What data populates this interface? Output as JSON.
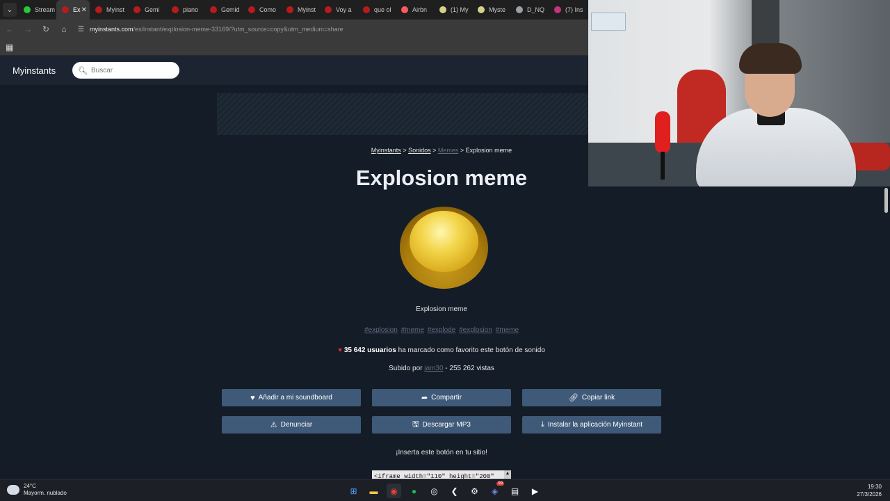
{
  "browser": {
    "tabs": [
      {
        "label": "Stream",
        "color": "#27c93f"
      },
      {
        "label": "Ex",
        "color": "#b71c1c",
        "active": true
      },
      {
        "label": "Myinst",
        "color": "#b71c1c"
      },
      {
        "label": "Gemi",
        "color": "#b71c1c"
      },
      {
        "label": "piano",
        "color": "#b71c1c"
      },
      {
        "label": "Gemid",
        "color": "#b71c1c"
      },
      {
        "label": "Como",
        "color": "#b71c1c"
      },
      {
        "label": "Myinst",
        "color": "#b71c1c"
      },
      {
        "label": "Voy a",
        "color": "#b71c1c"
      },
      {
        "label": "que ol",
        "color": "#b71c1c"
      },
      {
        "label": "Airbn",
        "color": "#ff5a5f"
      },
      {
        "label": "(1) My",
        "color": "#d7d28a"
      },
      {
        "label": "Myste",
        "color": "#d7d28a"
      },
      {
        "label": "D_NQ",
        "color": "#9aa0a6"
      },
      {
        "label": "(7) Ins",
        "color": "#c13584"
      }
    ],
    "url_host": "myinstants.com",
    "url_path": "/es/instant/explosion-meme-33169/?utm_source=copy&utm_medium=share"
  },
  "site": {
    "logo": "Myinstants",
    "search_placeholder": "Buscar"
  },
  "breadcrumb": {
    "home": "Myinstants",
    "sep1": " > ",
    "sounds": "Sonidos",
    "sep2": " > ",
    "memes": "Memes",
    "sep3": " > ",
    "current": "Explosion meme"
  },
  "sound": {
    "title": "Explosion meme",
    "name": "Explosion meme",
    "tags": [
      "#explosion",
      "#meme",
      "#explode",
      "#explosion",
      "#meme"
    ],
    "favorites_count": "35 642 usuarios",
    "favorites_text": " ha marcado como favorito este botón de sonido",
    "uploaded_prefix": "Subido por ",
    "uploader": "jam30",
    "views_text": " - 255 262 vistas"
  },
  "actions": {
    "add_soundboard": "Añadir a mi soundboard",
    "share": "Compartir",
    "copy_link": "Copiar link",
    "report": "Denunciar",
    "download": "Descargar MP3",
    "install_app": "Instalar la aplicación Myinstant"
  },
  "embed": {
    "heading": "¡Inserta este botón en tu sitio!",
    "code": "<iframe width=\"110\" height=\"200\""
  },
  "taskbar": {
    "temperature": "24°C",
    "weather": "Mayorm. nublado",
    "time": "19:30",
    "date": "27/3/2026",
    "discord_badge": "99"
  }
}
